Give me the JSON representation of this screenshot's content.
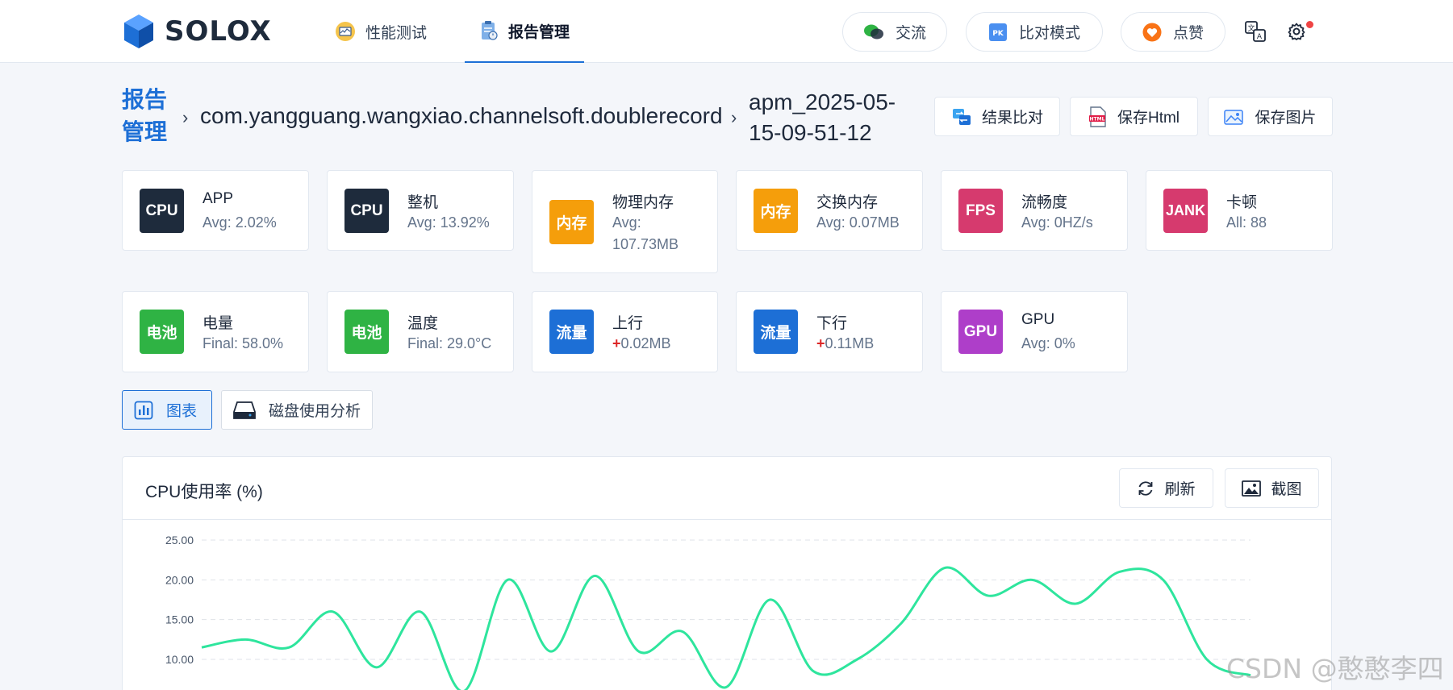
{
  "header": {
    "logo_text": "SOLOX",
    "nav": [
      {
        "label": "性能测试",
        "icon": "monitor-chart-icon",
        "active": false
      },
      {
        "label": "报告管理",
        "icon": "report-clipboard-icon",
        "active": true
      }
    ],
    "pills": [
      {
        "label": "交流",
        "icon": "wechat-chat-icon"
      },
      {
        "label": "比对模式",
        "icon": "pk-compare-icon"
      },
      {
        "label": "点赞",
        "icon": "heart-like-icon"
      }
    ],
    "tools": [
      "translate-icon",
      "settings-gear-icon"
    ]
  },
  "breadcrumb": {
    "root": "报告管理",
    "package": "com.yangguang.wangxiao.channelsoft.doublerecord",
    "file": "apm_2025-05-15-09-51-12",
    "separator": "›"
  },
  "actions": [
    {
      "label": "结果比对",
      "icon": "compare-arrows-icon"
    },
    {
      "label": "保存Html",
      "icon": "html-file-icon"
    },
    {
      "label": "保存图片",
      "icon": "image-icon"
    }
  ],
  "metrics": [
    {
      "badge": "CPU",
      "color": "#1e2b3c",
      "title": "APP",
      "value": "Avg: 2.02%"
    },
    {
      "badge": "CPU",
      "color": "#1e2b3c",
      "title": "整机",
      "value": "Avg: 13.92%"
    },
    {
      "badge": "内存",
      "color": "#f59e0b",
      "title": "物理内存",
      "value": "Avg: 107.73MB"
    },
    {
      "badge": "内存",
      "color": "#f59e0b",
      "title": "交换内存",
      "value": "Avg: 0.07MB"
    },
    {
      "badge": "FPS",
      "color": "#d63a6e",
      "title": "流畅度",
      "value": "Avg: 0HZ/s"
    },
    {
      "badge": "JANK",
      "color": "#d63a6e",
      "title": "卡顿",
      "value": "All: 88"
    },
    {
      "badge": "电池",
      "color": "#2fb344",
      "title": "电量",
      "value": "Final: 58.0%"
    },
    {
      "badge": "电池",
      "color": "#2fb344",
      "title": "温度",
      "value": "Final: 29.0°C"
    },
    {
      "badge": "流量",
      "color": "#1d6fd6",
      "title": "上行",
      "plus": "+",
      "value": "0.02MB"
    },
    {
      "badge": "流量",
      "color": "#1d6fd6",
      "title": "下行",
      "plus": "+",
      "value": "0.11MB"
    },
    {
      "badge": "GPU",
      "color": "#ae3ec9",
      "title": "GPU",
      "value": "Avg: 0%"
    }
  ],
  "tabs": [
    {
      "label": "图表",
      "icon": "bar-chart-icon",
      "active": true
    },
    {
      "label": "磁盘使用分析",
      "icon": "disk-drive-icon",
      "active": false
    }
  ],
  "chart_panel": {
    "title": "CPU使用率 (%)",
    "buttons": [
      {
        "label": "刷新",
        "icon": "refresh-icon"
      },
      {
        "label": "截图",
        "icon": "screenshot-image-icon"
      }
    ]
  },
  "chart_data": {
    "type": "line",
    "title": "CPU使用率 (%)",
    "yticks": [
      "25.00",
      "20.00",
      "15.00",
      "10.00"
    ],
    "ylim": [
      8,
      25
    ],
    "grid": true,
    "line_color": "#2ee59d",
    "series": [
      {
        "values": [
          11.5,
          12.5,
          11.5,
          16.0,
          9.0,
          16.0,
          6.0,
          20.0,
          11.0,
          20.5,
          11.0,
          13.5,
          6.5,
          17.5,
          8.5,
          10.0,
          14.5,
          21.5,
          18.0,
          20.0,
          17.0,
          21.0,
          20.0,
          10.0,
          8.0
        ]
      }
    ]
  },
  "watermark": "CSDN @憨憨李四"
}
